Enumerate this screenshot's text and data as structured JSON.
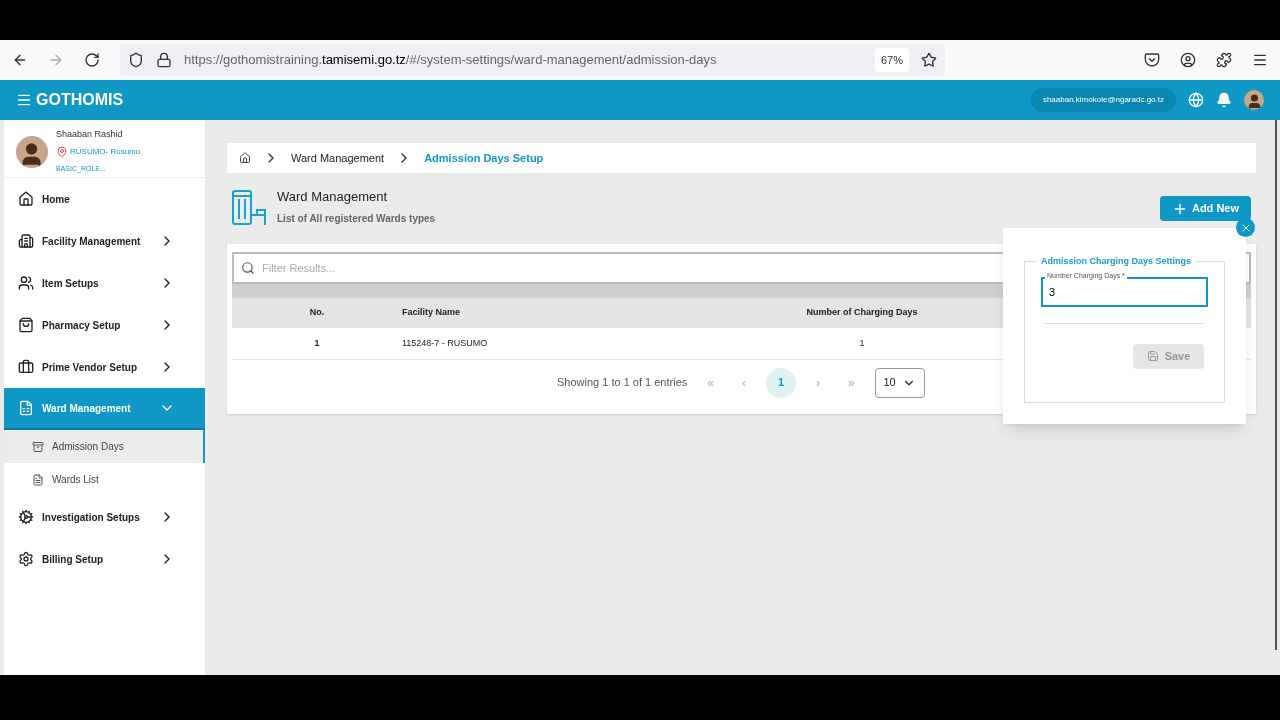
{
  "browser": {
    "url_prefix": "https://gothomistraining.",
    "url_domain": "tamisemi.go.tz",
    "url_rest": "/#/system-settings/ward-management/admission-days",
    "zoom": "67%"
  },
  "header": {
    "brand": "GOTHOMIS",
    "email": "shaaban.kimokole@ngaradc.go.tz"
  },
  "user": {
    "name": "Shaaban Rashid",
    "location": "RUSUMO- Rusumo",
    "role": "BASIC_ROLE..."
  },
  "sidebar": {
    "items": [
      {
        "label": "Home",
        "has_children": false,
        "expanded": false,
        "selected": false
      },
      {
        "label": "Facility Management",
        "has_children": true,
        "expanded": false,
        "selected": false
      },
      {
        "label": "Item Setups",
        "has_children": true,
        "expanded": false,
        "selected": false
      },
      {
        "label": "Pharmacy Setup",
        "has_children": true,
        "expanded": false,
        "selected": false
      },
      {
        "label": "Prime Vendor Setup",
        "has_children": true,
        "expanded": false,
        "selected": false
      },
      {
        "label": "Ward Management",
        "has_children": true,
        "expanded": true,
        "selected": true,
        "children": [
          {
            "label": "Admission Days",
            "selected": true
          },
          {
            "label": "Wards List",
            "selected": false
          }
        ]
      },
      {
        "label": "Investigation Setups",
        "has_children": true,
        "expanded": false,
        "selected": false
      },
      {
        "label": "Billing Setup",
        "has_children": true,
        "expanded": false,
        "selected": false
      }
    ]
  },
  "breadcrumb": [
    {
      "label": "Ward Management",
      "selected": false
    },
    {
      "label": "Admission Days Setup",
      "selected": true
    }
  ],
  "page": {
    "title": "Ward Management",
    "subtitle": "List of All registered Wards types",
    "add_button": "Add New"
  },
  "table": {
    "filter_placeholder": "Filter Results...",
    "columns": [
      "No.",
      "Facility Name",
      "Number of Charging Days"
    ],
    "rows": [
      [
        "1",
        "115248-7 - RUSUMO",
        "1"
      ]
    ]
  },
  "pagination": {
    "summary": "Showing 1 to 1 of 1 entries",
    "first": "«",
    "prev": "‹",
    "pages": [
      {
        "label": "1",
        "selected": true
      }
    ],
    "next": "›",
    "last": "»",
    "page_size": "10"
  },
  "popup": {
    "legend": "Admission Charging Days Settings",
    "field_label": "Number Charging Days *",
    "field_value": "3",
    "save_button": "Save",
    "save_disabled": true
  }
}
